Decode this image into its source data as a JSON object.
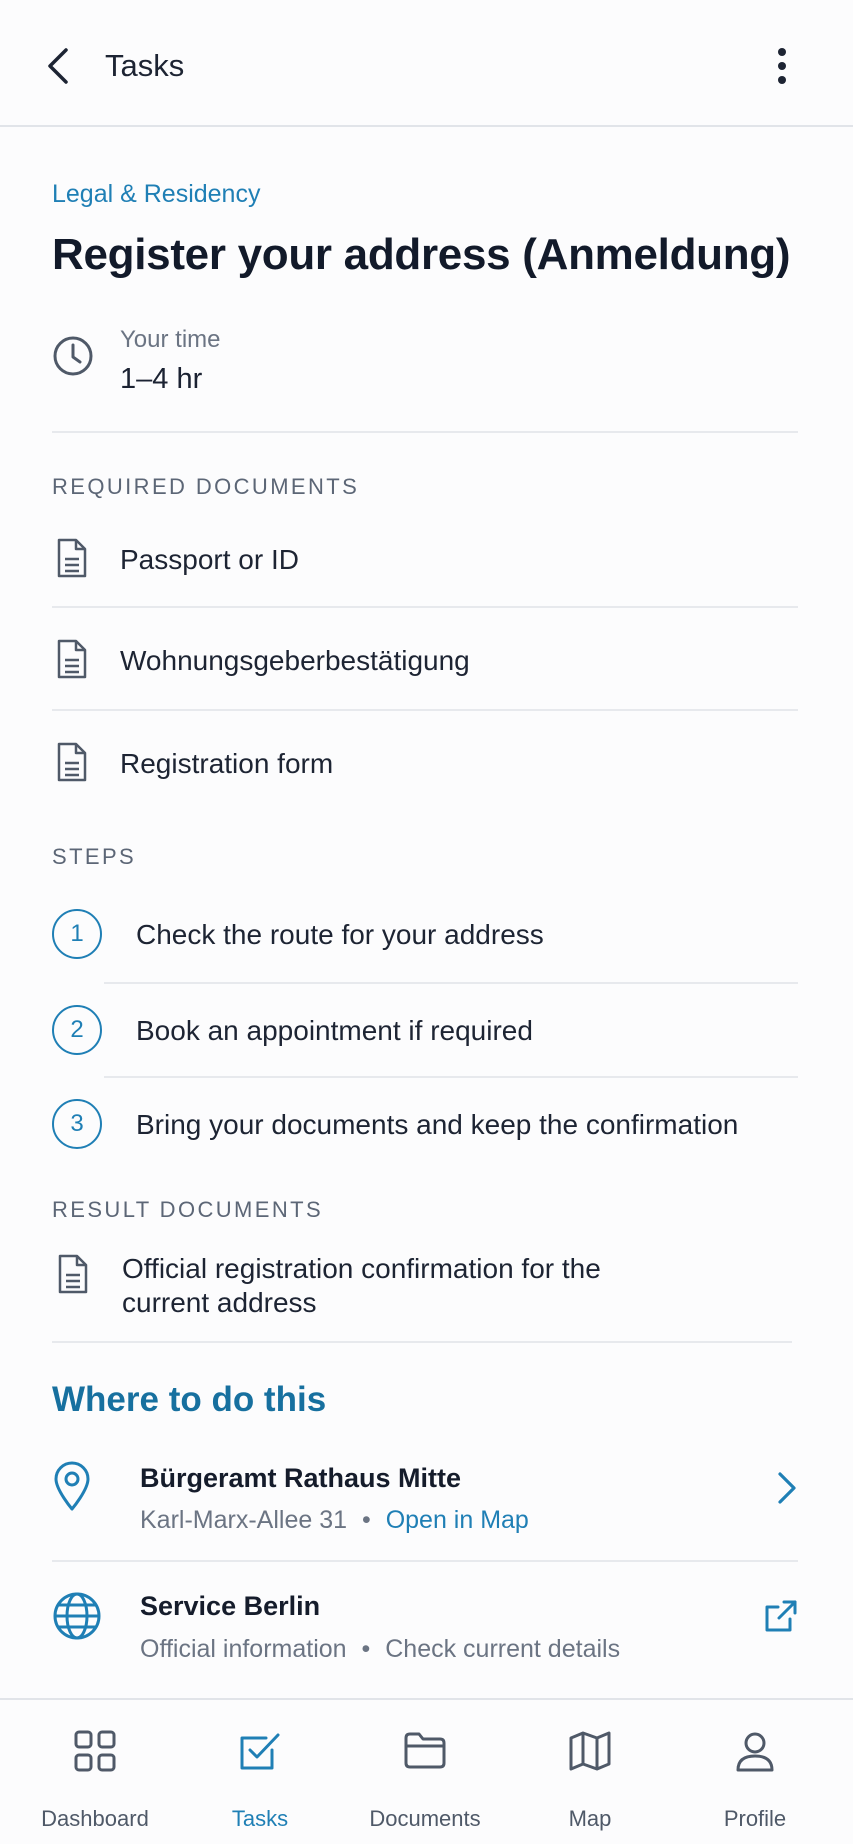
{
  "header": {
    "title": "Tasks"
  },
  "task": {
    "category": "Legal & Residency",
    "title": "Register your address (Anmeldung)",
    "time_label": "Your time",
    "time_value": "1–4 hr"
  },
  "required_documents": {
    "heading": "REQUIRED DOCUMENTS",
    "items": [
      {
        "label": "Passport or ID",
        "icon": "document-icon"
      },
      {
        "label": "Wohnungsgeberbestätigung",
        "icon": "document-icon"
      },
      {
        "label": "Registration form",
        "icon": "document-icon"
      }
    ]
  },
  "steps": {
    "heading": "STEPS",
    "items": [
      {
        "number": "1",
        "label": "Check the route for your address"
      },
      {
        "number": "2",
        "label": "Book an appointment if required"
      },
      {
        "number": "3",
        "label": "Bring your documents and keep the confirmation"
      }
    ]
  },
  "result_documents": {
    "heading": "RESULT DOCUMENTS",
    "items": [
      {
        "label": "Official registration confirmation for the current address",
        "icon": "document-icon"
      }
    ]
  },
  "where": {
    "heading": "Where to do this",
    "places": [
      {
        "name": "Bürgeramt Rathaus Mitte",
        "address": "Karl-Marx-Allee 31",
        "separator": "•",
        "link": "Open in Map",
        "icon": "location-pin-icon",
        "action_icon": "chevron-right-icon"
      },
      {
        "name": "Service Berlin",
        "address": "Official information",
        "separator": "•",
        "link": "Check current details",
        "icon": "globe-icon",
        "action_icon": "external-link-icon"
      }
    ]
  },
  "nav": {
    "items": [
      {
        "label": "Dashboard",
        "icon": "grid-icon",
        "active": false
      },
      {
        "label": "Tasks",
        "icon": "checkbox-icon",
        "active": true
      },
      {
        "label": "Documents",
        "icon": "folder-icon",
        "active": false
      },
      {
        "label": "Map",
        "icon": "map-icon",
        "active": false
      },
      {
        "label": "Profile",
        "icon": "user-icon",
        "active": false
      }
    ]
  },
  "colors": {
    "accent": "#1f7fb5",
    "heading_accent": "#17709f",
    "text": "#17202f",
    "muted": "#6b7483",
    "divider": "#e7e9ed"
  }
}
